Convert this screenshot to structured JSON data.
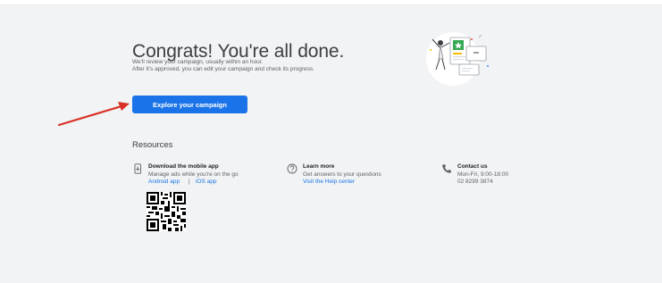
{
  "page": {
    "title": "Congrats! You're all done.",
    "line1": "We'll review your campaign, usually within an hour.",
    "line2": "After it's approved, you can edit your campaign and check its progress.",
    "cta_label": "Explore your campaign"
  },
  "resources": {
    "heading": "Resources",
    "mobile": {
      "icon": "mobile-download-icon",
      "title": "Download the mobile app",
      "desc": "Manage ads while you're on the go",
      "android": "Android app",
      "separator": "|",
      "ios": "iOS app"
    },
    "learn": {
      "icon": "help-icon",
      "title": "Learn more",
      "desc": "Get answers to your questions",
      "link": "Visit the Help center"
    },
    "contact": {
      "icon": "phone-icon",
      "title": "Contact us",
      "hours": "Mon-Fri, 9:00-18:00",
      "phone": "02 8299 3874"
    }
  },
  "colors": {
    "accent": "#1a73e8",
    "arrow": "#d93025",
    "background": "#f1f3f4"
  }
}
